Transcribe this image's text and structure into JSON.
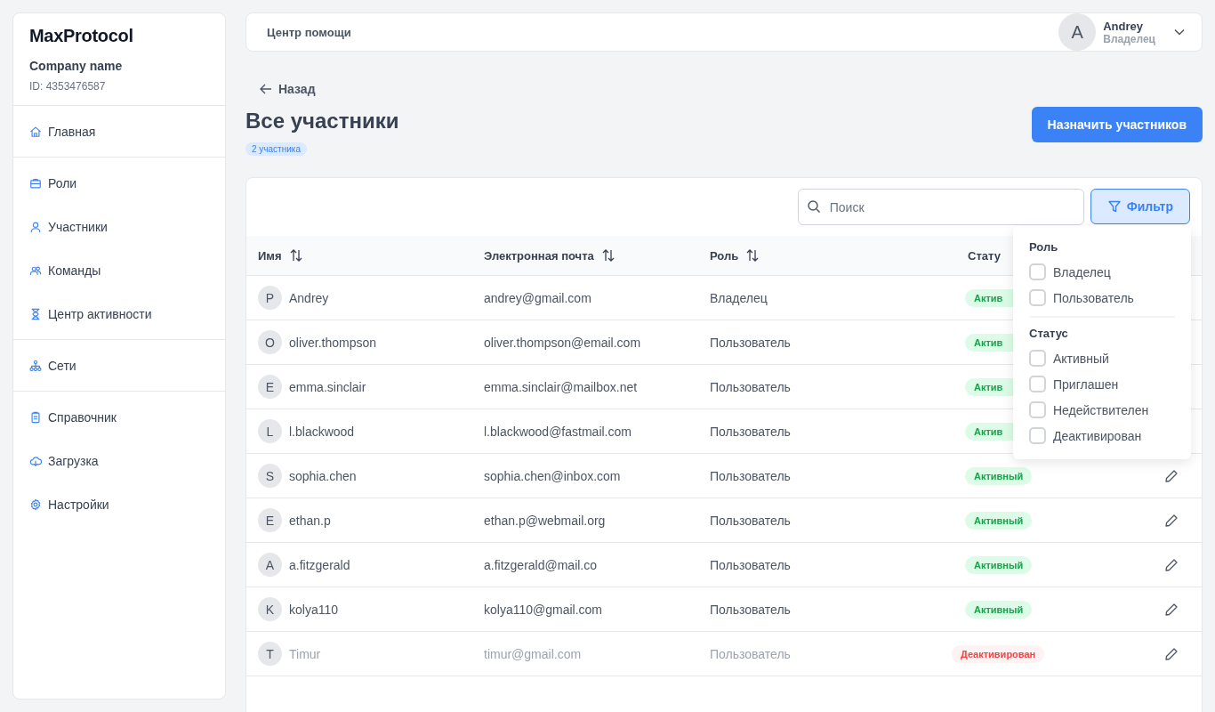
{
  "sidebar": {
    "logo": "MaxProtocol",
    "company": "Company name",
    "company_id": "ID: 4353476587",
    "sections": [
      [
        {
          "kind": "home",
          "label": "Главная"
        }
      ],
      [
        {
          "kind": "roles",
          "label": "Роли"
        },
        {
          "kind": "members",
          "label": "Участники"
        },
        {
          "kind": "teams",
          "label": "Команды"
        },
        {
          "kind": "activity",
          "label": "Центр активности"
        }
      ],
      [
        {
          "kind": "networks",
          "label": "Сети"
        }
      ],
      [
        {
          "kind": "reference",
          "label": "Справочник"
        },
        {
          "kind": "upload",
          "label": "Загрузка"
        },
        {
          "kind": "settings",
          "label": "Настройки"
        }
      ]
    ]
  },
  "header": {
    "title": "Центр помощи",
    "user": {
      "initial": "A",
      "name": "Andrey",
      "role": "Владелец"
    }
  },
  "back": "Назад",
  "page_title": "Все участники",
  "count_badge": "2 участника",
  "assign_button": "Назначить участников",
  "search": {
    "placeholder": "Поиск"
  },
  "filter_button": "Фильтр",
  "table": {
    "columns": [
      {
        "label": "Имя",
        "sortable": true
      },
      {
        "label": "Электронная почта",
        "sortable": true
      },
      {
        "label": "Роль",
        "sortable": true
      },
      {
        "label": "Стату"
      }
    ],
    "rows": [
      {
        "initial": "P",
        "name": "Andrey",
        "email": "andrey@gmail.com",
        "role": "Владелец",
        "status": "Актив",
        "kind": "active"
      },
      {
        "initial": "O",
        "name": "oliver.thompson",
        "email": "oliver.thompson@email.com",
        "role": "Пользователь",
        "status": "Актив",
        "kind": "active"
      },
      {
        "initial": "E",
        "name": "emma.sinclair",
        "email": "emma.sinclair@mailbox.net",
        "role": "Пользователь",
        "status": "Актив",
        "kind": "active"
      },
      {
        "initial": "L",
        "name": "l.blackwood",
        "email": "l.blackwood@fastmail.com",
        "role": "Пользователь",
        "status": "Актив",
        "kind": "active"
      },
      {
        "initial": "S",
        "name": "sophia.chen",
        "email": "sophia.chen@inbox.com",
        "role": "Пользователь",
        "status": "Активный",
        "kind": "active"
      },
      {
        "initial": "E",
        "name": "ethan.p",
        "email": "ethan.p@webmail.org",
        "role": "Пользователь",
        "status": "Активный",
        "kind": "active"
      },
      {
        "initial": "A",
        "name": "a.fitzgerald",
        "email": "a.fitzgerald@mail.co",
        "role": "Пользователь",
        "status": "Активный",
        "kind": "active"
      },
      {
        "initial": "K",
        "name": "kolya110",
        "email": "kolya110@gmail.com",
        "role": "Пользователь",
        "status": "Активный",
        "kind": "active"
      },
      {
        "initial": "T",
        "name": "Timur",
        "email": "timur@gmail.com",
        "role": "Пользователь",
        "status": "Деактивирован",
        "kind": "deactivated"
      }
    ]
  },
  "filter_menu": {
    "groups": [
      {
        "title": "Роль",
        "options": [
          {
            "label": "Владелец",
            "checked": false
          },
          {
            "label": "Пользователь",
            "checked": false
          }
        ]
      },
      {
        "title": "Статус",
        "options": [
          {
            "label": "Активный",
            "checked": false
          },
          {
            "label": "Приглашен",
            "checked": false
          },
          {
            "label": "Недействителен",
            "checked": false
          },
          {
            "label": "Деактивирован",
            "checked": false
          }
        ]
      }
    ]
  }
}
